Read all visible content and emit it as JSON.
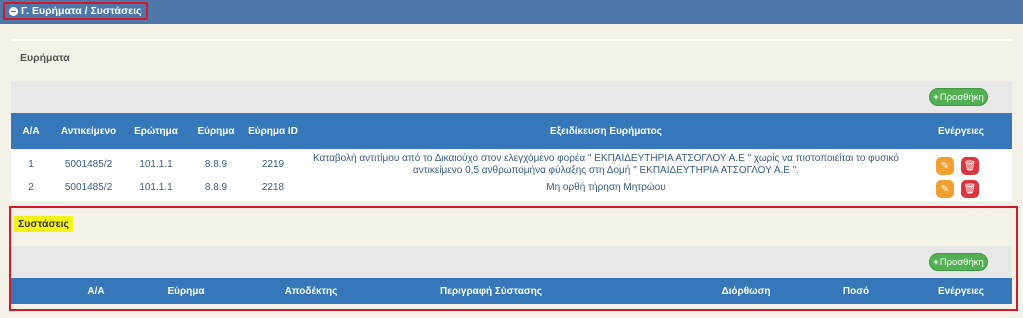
{
  "section": {
    "title": "Γ. Ευρήματα / Συστάσεις"
  },
  "findings": {
    "title": "Ευρήματα",
    "add_label": "Προσθήκη",
    "columns": [
      "Α/Α",
      "Αντικείμενο",
      "Ερώτημα",
      "Εύρημα",
      "Εύρημα ID",
      "Εξειδίκευση Ευρήματος",
      "Ενέργειες"
    ],
    "rows": [
      {
        "aa": "1",
        "object": "5001485/2",
        "question": "101.1.1",
        "finding": "8.8.9",
        "finding_id": "2219",
        "detail": "Καταβολή αντιτίμου από το Δικαιούχο στον ελεγχόμενο φορέα \" ΕΚΠΑΙΔΕΥΤΗΡΙΑ ΑΤΣΟΓΛΟΥ Α.Ε \" χωρίς να πιστοποιείται το φυσικό αντικείμενο 0,5 ανθρωπομήνα φύλαξης στη Δομή \" ΕΚΠΑΙΔΕΥΤΗΡΙΑ ΑΤΣΟΓΛΟΥ Α.Ε \"."
      },
      {
        "aa": "2",
        "object": "5001485/2",
        "question": "101.1.1",
        "finding": "8.8.9",
        "finding_id": "2218",
        "detail": "Μη ορθή τήρηση Μητρώου"
      }
    ]
  },
  "recommendations": {
    "title": "Συστάσεις",
    "add_label": "Προσθήκη",
    "columns": [
      "Α/Α",
      "Εύρημα",
      "Αποδέκτης",
      "Περιγραφή Σύστασης",
      "Διόρθωση",
      "Ποσό",
      "Ενέργειες"
    ]
  },
  "colors": {
    "header_blue": "#3577b8",
    "topbar_blue": "#4f78a8",
    "add_green": "#53b153",
    "highlight_red": "#d0192b",
    "highlight_yellow": "#f3f31a"
  },
  "icons": {
    "collapse": "minus-circle-icon",
    "edit": "edit-icon",
    "delete": "trash-icon"
  }
}
